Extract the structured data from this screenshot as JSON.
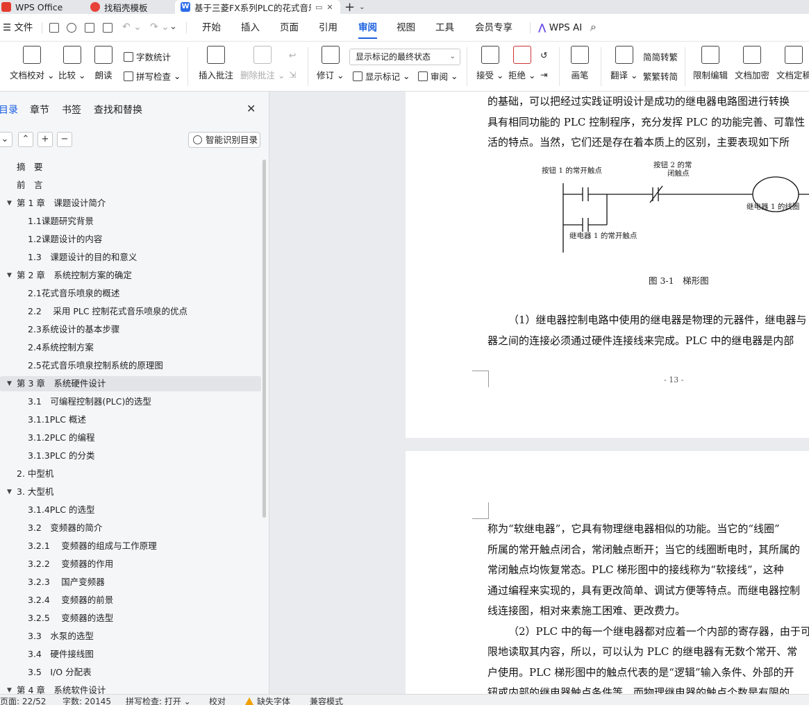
{
  "tabs": [
    {
      "label": "WPS Office",
      "icon": "wps-logo-icon"
    },
    {
      "label": "找稻壳模板",
      "icon": "daoke-icon"
    },
    {
      "label": "基于三菱FX系列PLC的花式音乐",
      "icon": "word-doc-icon"
    }
  ],
  "menubar": {
    "file": "文件",
    "items": [
      "开始",
      "插入",
      "页面",
      "引用",
      "审阅",
      "视图",
      "工具",
      "会员专享"
    ],
    "active": "审阅",
    "wps_ai": "WPS AI"
  },
  "ribbon": {
    "doc_check": "文档校对",
    "compare": "比较",
    "read_aloud": "朗读",
    "word_count": "字数统计",
    "spell_check": "拼写检查",
    "insert_comment": "插入批注",
    "delete_comment": "删除批注",
    "revise": "修订",
    "markup_select": "显示标记的最终状态",
    "show_markup": "显示标记",
    "review": "审阅",
    "accept": "接受",
    "reject": "拒绝",
    "pen": "画笔",
    "translate": "翻译",
    "to_traditional": "简转繁",
    "to_simplified": "繁转简",
    "restrict_edit": "限制编辑",
    "doc_encrypt": "文档加密",
    "doc_final": "文档定稿"
  },
  "nav": {
    "tabs": [
      "目录",
      "章节",
      "书签",
      "查找和替换"
    ],
    "smart_button": "智能识别目录",
    "toc": [
      {
        "text": "摘　要",
        "level": 0,
        "caret": false
      },
      {
        "text": "前　言",
        "level": 0,
        "caret": false
      },
      {
        "text": "第 1 章　课题设计简介",
        "level": 0,
        "caret": true
      },
      {
        "text": "1.1课题研究背景",
        "level": 1,
        "caret": false
      },
      {
        "text": "1.2课题设计的内容",
        "level": 1,
        "caret": false
      },
      {
        "text": "1.3　课题设计的目的和意义",
        "level": 1,
        "caret": false
      },
      {
        "text": "第 2 章　系统控制方案的确定",
        "level": 0,
        "caret": true
      },
      {
        "text": "2.1花式音乐喷泉的概述",
        "level": 1,
        "caret": false
      },
      {
        "text": "2.2　 采用 PLC 控制花式音乐喷泉的优点",
        "level": 1,
        "caret": false
      },
      {
        "text": "2.3系统设计的基本步骤",
        "level": 1,
        "caret": false
      },
      {
        "text": "2.4系统控制方案",
        "level": 1,
        "caret": false
      },
      {
        "text": "2.5花式音乐喷泉控制系统的原理图",
        "level": 1,
        "caret": false
      },
      {
        "text": "第 3 章　系统硬件设计",
        "level": 0,
        "caret": true
      },
      {
        "text": "3.1　可编程控制器(PLC)的选型",
        "level": 1,
        "caret": false
      },
      {
        "text": "3.1.1PLC 概述",
        "level": 1,
        "caret": false
      },
      {
        "text": "3.1.2PLC 的编程",
        "level": 1,
        "caret": false
      },
      {
        "text": "3.1.3PLC 的分类",
        "level": 1,
        "caret": false
      },
      {
        "text": "2. 中型机",
        "level": 0,
        "caret": false
      },
      {
        "text": "3. 大型机",
        "level": 0,
        "caret": true
      },
      {
        "text": "3.1.4PLC 的选型",
        "level": 1,
        "caret": false
      },
      {
        "text": "3.2　变频器的简介",
        "level": 1,
        "caret": false
      },
      {
        "text": "3.2.1　 变频器的组成与工作原理",
        "level": 1,
        "caret": false
      },
      {
        "text": "3.2.2　 变频器的作用",
        "level": 1,
        "caret": false
      },
      {
        "text": "3.2.3　 国产变频器",
        "level": 1,
        "caret": false
      },
      {
        "text": "3.2.4　 变频器的前景",
        "level": 1,
        "caret": false
      },
      {
        "text": "3.2.5　 变频器的选型",
        "level": 1,
        "caret": false
      },
      {
        "text": "3.3　水泵的选型",
        "level": 1,
        "caret": false
      },
      {
        "text": "3.4　硬件接线图",
        "level": 1,
        "caret": false
      },
      {
        "text": "3.5　I/O 分配表",
        "level": 1,
        "caret": false
      },
      {
        "text": "第 4 章　系统软件设计",
        "level": 0,
        "caret": true
      }
    ],
    "selected_index": 12
  },
  "doc": {
    "page1_lines": [
      "的基础，可以把经过实践证明设计是成功的继电器电路图进行转换",
      "具有相同功能的 PLC 控制程序，充分发挥 PLC 的功能完善、可靠性",
      "活的特点。当然，它们还是存在着本质上的区别，主要表现如下所"
    ],
    "diagram": {
      "button1": "按钮 1 的常开触点",
      "button2_line1": "按钮 2 的常",
      "button2_line2": "闭触点",
      "coil": "继电器 1 的线圈",
      "relay_contact": "继电器 1 的常开触点"
    },
    "figure_caption": "图 3-1　梯形图",
    "para1_lines": [
      "（1）继电器控制电路中使用的继电器是物理的元器件，继电器与",
      "器之间的连接必须通过硬件连接线来完成。PLC 中的继电器是内部"
    ],
    "page_number": "- 13 -",
    "page2_lines": [
      "称为“软继电器”，它具有物理继电器相似的功能。当它的“线圈”",
      "所属的常开触点闭合，常闭触点断开；当它的线圈断电时，其所属的",
      "常闭触点均恢复常态。PLC 梯形图中的接线称为“软接线”，这种",
      "通过编程来实现的，具有更改简单、调试方便等特点。而继电器控制",
      "线连接图，相对来素施工困难、更改费力。",
      "（2）PLC 中的每一个继电器都对应着一个内部的寄存器，由于可",
      "限地读取其内容，所以，可以认为 PLC 的继电器有无数个常开、常",
      "户使用。PLC 梯形图中的触点代表的是“逻辑”输入条件、外部的开",
      "钮或内部的继电器触点条件等，而物理继电器的触点个数是有限的"
    ]
  },
  "status": {
    "page": "页面: 22/52",
    "words": "字数: 20145",
    "spell": "拼写检查: 打开",
    "proof": "校对",
    "missing_font": "缺失字体",
    "compat": "兼容模式"
  }
}
